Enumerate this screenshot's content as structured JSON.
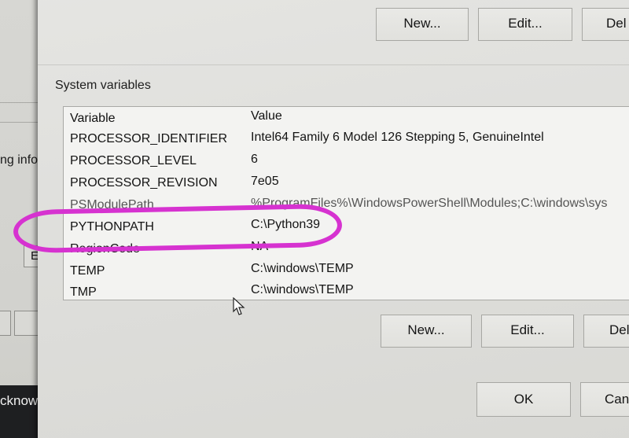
{
  "background_window": {
    "truncated_text_1": "ng info",
    "edit_button_label": "E",
    "truncated_text_2": "cknow"
  },
  "dialog": {
    "user_buttons": {
      "new_label": "New...",
      "edit_label": "Edit...",
      "delete_label": "Del"
    },
    "system_variables": {
      "group_label": "System variables",
      "columns": {
        "variable": "Variable",
        "value": "Value"
      },
      "rows": [
        {
          "variable": "PROCESSOR_IDENTIFIER",
          "value": "Intel64 Family 6 Model 126 Stepping 5, GenuineIntel"
        },
        {
          "variable": "PROCESSOR_LEVEL",
          "value": "6"
        },
        {
          "variable": "PROCESSOR_REVISION",
          "value": "7e05"
        },
        {
          "variable": "PSModulePath",
          "value": "%ProgramFiles%\\WindowsPowerShell\\Modules;C:\\windows\\sys"
        },
        {
          "variable": "PYTHONPATH",
          "value": "C:\\Python39"
        },
        {
          "variable": "RegionCode",
          "value": "NA"
        },
        {
          "variable": "TEMP",
          "value": "C:\\windows\\TEMP"
        },
        {
          "variable": "TMP",
          "value": "C:\\windows\\TEMP"
        }
      ]
    },
    "system_buttons": {
      "new_label": "New...",
      "edit_label": "Edit...",
      "delete_label": "Del"
    },
    "footer": {
      "ok_label": "OK",
      "cancel_label": "Can"
    }
  },
  "annotation": {
    "highlight_color": "#d632d0"
  }
}
